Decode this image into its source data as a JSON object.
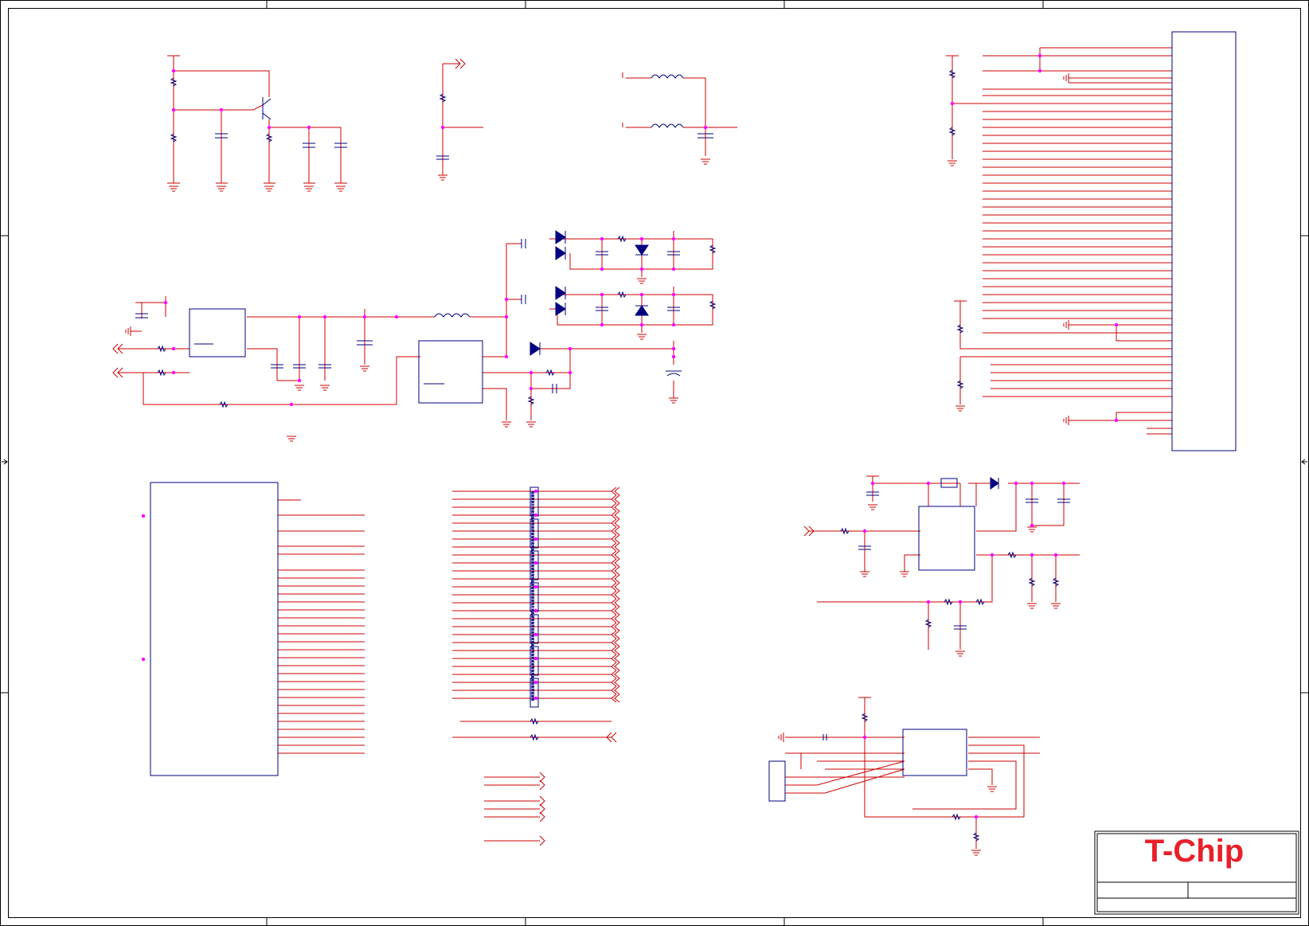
{
  "logo": {
    "text": "T-Chip",
    "color": "#e8202a"
  },
  "colors": {
    "wire": "#cc0000",
    "component": "#000080",
    "junction": "#ff00ff",
    "border": "#000000"
  }
}
